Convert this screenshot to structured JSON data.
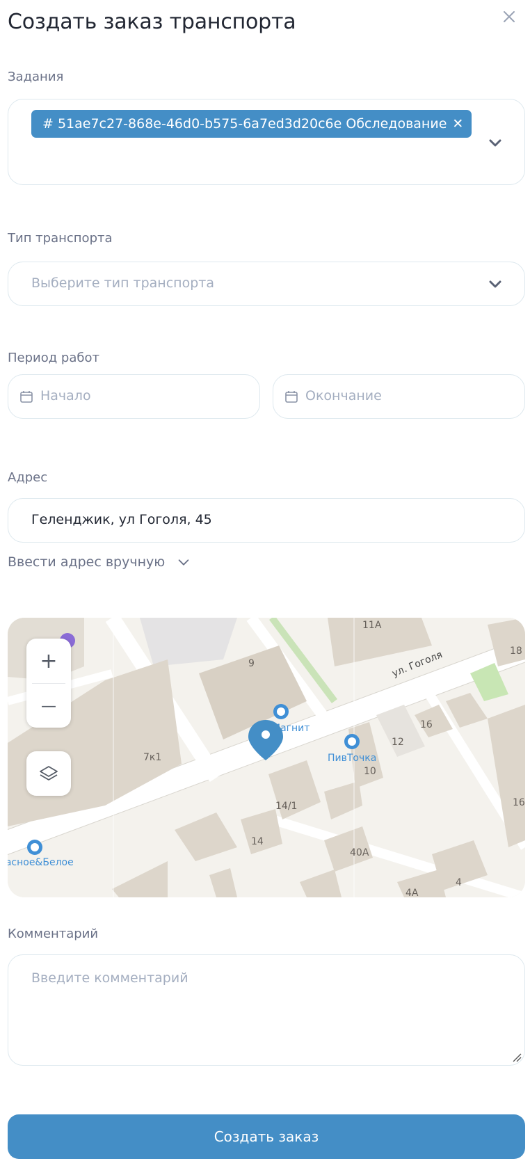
{
  "dialog": {
    "title": "Создать заказ транспорта"
  },
  "tasks": {
    "label": "Задания",
    "chip_text": "# 51ae7c27-868e-46d0-b575-6a7ed3d20c6e Обследование",
    "chip_remove": "✕"
  },
  "transport_type": {
    "label": "Тип транспорта",
    "placeholder": "Выберите тип транспорта"
  },
  "work_period": {
    "label": "Период работ",
    "start_placeholder": "Начало",
    "end_placeholder": "Окончание"
  },
  "address": {
    "label": "Адрес",
    "value": "Геленджик, ул Гоголя, 45",
    "manual_toggle": "Ввести адрес вручную"
  },
  "map": {
    "zoom_in": "+",
    "zoom_out": "—",
    "labels": {
      "street": "ул. Гоголя",
      "b9": "9",
      "b11a": "11А",
      "b18": "18",
      "b16a": "16",
      "b12": "12",
      "b10": "10",
      "b7k1": "7к1",
      "b14_1": "14/1",
      "b14": "14",
      "b40a": "40А",
      "b4": "4",
      "b4a": "4А",
      "b16b": "16",
      "poi_magnit": "Магнит",
      "poi_pivtochka": "ПивТочка",
      "poi_kb": "Красное&Белое"
    },
    "colors": {
      "marker": "#448ec6",
      "poi": "#3f8fd6",
      "building": "#ddd6cb"
    }
  },
  "comment": {
    "label": "Комментарий",
    "placeholder": "Введите комментарий"
  },
  "submit": {
    "label": "Создать заказ"
  },
  "colors": {
    "accent": "#448ec6",
    "label": "#6a7187",
    "placeholder": "#a4aec0",
    "border": "#dde8ee"
  }
}
